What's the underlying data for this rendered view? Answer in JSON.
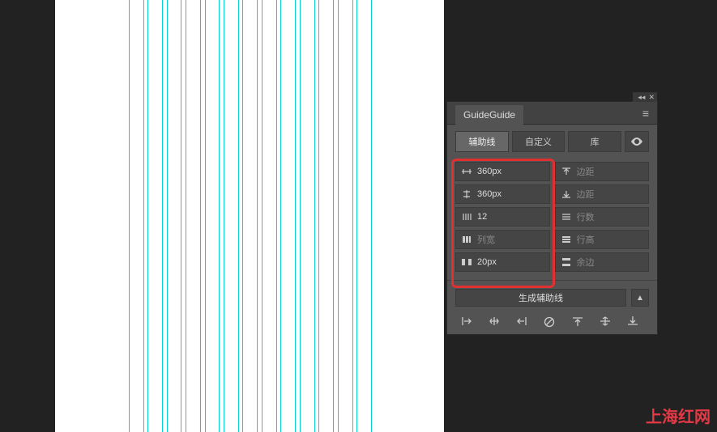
{
  "panel": {
    "title": "GuideGuide",
    "tabs": {
      "guides": "辅助线",
      "custom": "自定义",
      "library": "库"
    },
    "fields": {
      "left": [
        {
          "value": "360px",
          "placeholder": ""
        },
        {
          "value": "360px",
          "placeholder": ""
        },
        {
          "value": "12",
          "placeholder": ""
        },
        {
          "value": "",
          "placeholder": "列宽"
        },
        {
          "value": "20px",
          "placeholder": ""
        }
      ],
      "right": [
        {
          "value": "",
          "placeholder": "边距"
        },
        {
          "value": "",
          "placeholder": "边距"
        },
        {
          "value": "",
          "placeholder": "行数"
        },
        {
          "value": "",
          "placeholder": "行高"
        },
        {
          "value": "",
          "placeholder": "余边"
        }
      ]
    },
    "generate_button": "生成辅助线"
  },
  "watermark": "上海红网",
  "guides": {
    "positions": [
      159,
      177,
      182,
      200,
      206,
      223,
      229,
      247,
      253,
      270,
      276,
      294,
      299,
      317,
      323,
      341,
      346,
      364,
      370,
      388,
      393,
      411,
      417,
      435,
      440,
      458
    ]
  }
}
